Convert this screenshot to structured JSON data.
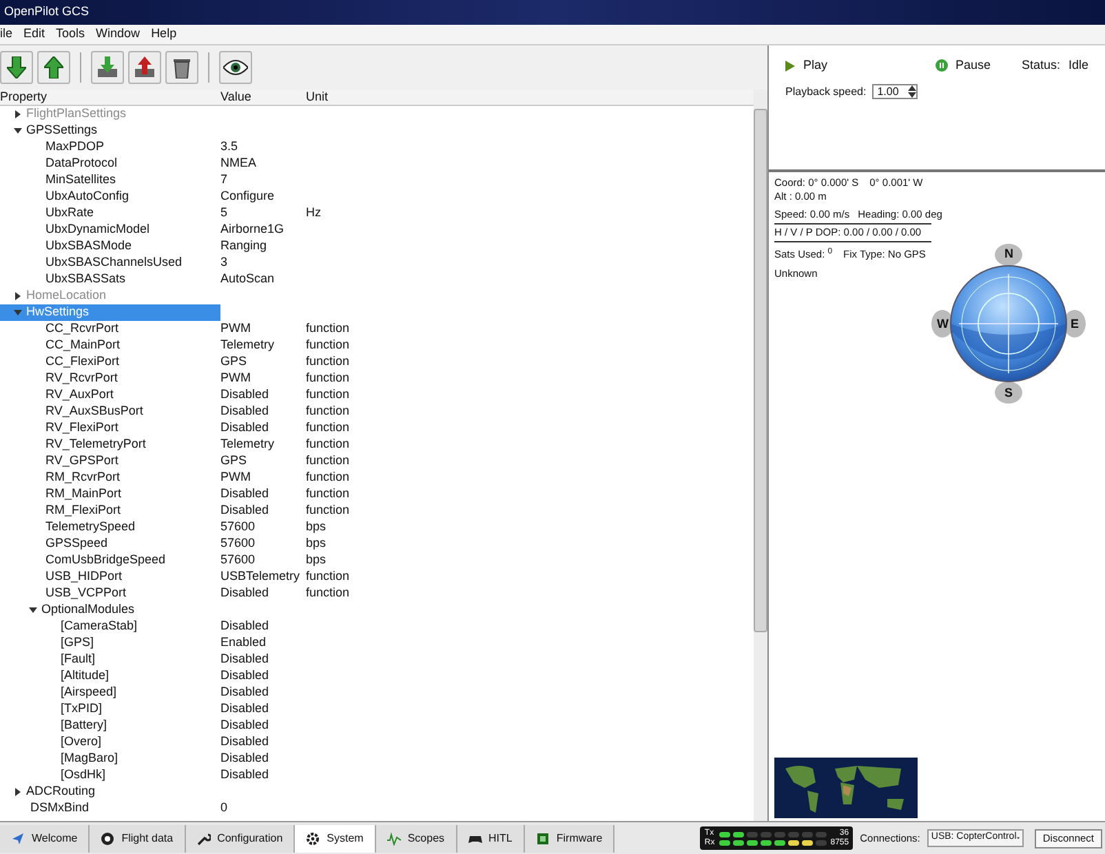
{
  "window": {
    "title": "OpenPilot GCS"
  },
  "menu": [
    "ile",
    "Edit",
    "Tools",
    "Window",
    "Help"
  ],
  "table": {
    "columns": [
      "Property",
      "Value",
      "Unit"
    ],
    "rows": [
      {
        "name": "FlightPlanSettings",
        "expanded": false,
        "dimmed": true,
        "selected": false
      },
      {
        "name": "GPSSettings",
        "expanded": true,
        "dimmed": false,
        "selected": false,
        "children": [
          {
            "name": "MaxPDOP",
            "value": "3.5"
          },
          {
            "name": "DataProtocol",
            "value": "NMEA"
          },
          {
            "name": "MinSatellites",
            "value": "7"
          },
          {
            "name": "UbxAutoConfig",
            "value": "Configure"
          },
          {
            "name": "UbxRate",
            "value": "5",
            "unit": "Hz"
          },
          {
            "name": "UbxDynamicModel",
            "value": "Airborne1G"
          },
          {
            "name": "UbxSBASMode",
            "value": "Ranging"
          },
          {
            "name": "UbxSBASChannelsUsed",
            "value": "3"
          },
          {
            "name": "UbxSBASSats",
            "value": "AutoScan"
          }
        ]
      },
      {
        "name": "HomeLocation",
        "expanded": false,
        "dimmed": true,
        "selected": false
      },
      {
        "name": "HwSettings",
        "expanded": true,
        "dimmed": false,
        "selected": true,
        "children": [
          {
            "name": "CC_RcvrPort",
            "value": "PWM",
            "unit": "function"
          },
          {
            "name": "CC_MainPort",
            "value": "Telemetry",
            "unit": "function"
          },
          {
            "name": "CC_FlexiPort",
            "value": "GPS",
            "unit": "function"
          },
          {
            "name": "RV_RcvrPort",
            "value": "PWM",
            "unit": "function"
          },
          {
            "name": "RV_AuxPort",
            "value": "Disabled",
            "unit": "function"
          },
          {
            "name": "RV_AuxSBusPort",
            "value": "Disabled",
            "unit": "function"
          },
          {
            "name": "RV_FlexiPort",
            "value": "Disabled",
            "unit": "function"
          },
          {
            "name": "RV_TelemetryPort",
            "value": "Telemetry",
            "unit": "function"
          },
          {
            "name": "RV_GPSPort",
            "value": "GPS",
            "unit": "function"
          },
          {
            "name": "RM_RcvrPort",
            "value": "PWM",
            "unit": "function"
          },
          {
            "name": "RM_MainPort",
            "value": "Disabled",
            "unit": "function"
          },
          {
            "name": "RM_FlexiPort",
            "value": "Disabled",
            "unit": "function"
          },
          {
            "name": "TelemetrySpeed",
            "value": "57600",
            "unit": "bps"
          },
          {
            "name": "GPSSpeed",
            "value": "57600",
            "unit": "bps"
          },
          {
            "name": "ComUsbBridgeSpeed",
            "value": "57600",
            "unit": "bps"
          },
          {
            "name": "USB_HIDPort",
            "value": "USBTelemetry",
            "unit": "function"
          },
          {
            "name": "USB_VCPPort",
            "value": "Disabled",
            "unit": "function"
          },
          {
            "name": "OptionalModules",
            "expanded": true,
            "dimmed": false,
            "selected": false,
            "children": [
              {
                "name": "[CameraStab]",
                "value": "Disabled"
              },
              {
                "name": "[GPS]",
                "value": "Enabled"
              },
              {
                "name": "[Fault]",
                "value": "Disabled"
              },
              {
                "name": "[Altitude]",
                "value": "Disabled"
              },
              {
                "name": "[Airspeed]",
                "value": "Disabled"
              },
              {
                "name": "[TxPID]",
                "value": "Disabled"
              },
              {
                "name": "[Battery]",
                "value": "Disabled"
              },
              {
                "name": "[Overo]",
                "value": "Disabled"
              },
              {
                "name": "[MagBaro]",
                "value": "Disabled"
              },
              {
                "name": "[OsdHk]",
                "value": "Disabled"
              }
            ]
          }
        ]
      },
      {
        "name": "ADCRouting",
        "expanded": false,
        "dimmed": false,
        "selected": false
      },
      {
        "name": "DSMxBind",
        "value": "0"
      }
    ]
  },
  "playback": {
    "play": "Play",
    "pause": "Pause",
    "status_label": "Status:",
    "status": "Idle",
    "speed_label": "Playback speed:",
    "speed": "1.00"
  },
  "gps": {
    "coord": "Coord: 0° 0.000' S",
    "coord_2": "0° 0.001' W",
    "alt": "Alt : 0.00 m",
    "speed": "Speed: 0.00 m/s",
    "heading": "Heading: 0.00 deg",
    "dop": "H / V / P DOP: 0.00 / 0.00 / 0.00",
    "sats_label": "Sats Used:",
    "sats": "0",
    "fix": "Fix Type: No GPS",
    "status": "Unknown",
    "compass": [
      "N",
      "E",
      "S",
      "W"
    ]
  },
  "tabs": [
    {
      "label": "Welcome",
      "selected": false
    },
    {
      "label": "Flight data",
      "selected": false
    },
    {
      "label": "Configuration",
      "selected": false
    },
    {
      "label": "System",
      "selected": true
    },
    {
      "label": "Scopes",
      "selected": false
    },
    {
      "label": "HITL",
      "selected": false
    },
    {
      "label": "Firmware",
      "selected": false
    }
  ],
  "meter": {
    "tx": {
      "label": "Tx",
      "level": 0.25,
      "reading": "36"
    },
    "rx": {
      "label": "Rx",
      "level": 0.875,
      "reading": "8755"
    }
  },
  "connection": {
    "label": "Connections:",
    "device": "USB: CopterControl",
    "button": "Disconnect"
  }
}
